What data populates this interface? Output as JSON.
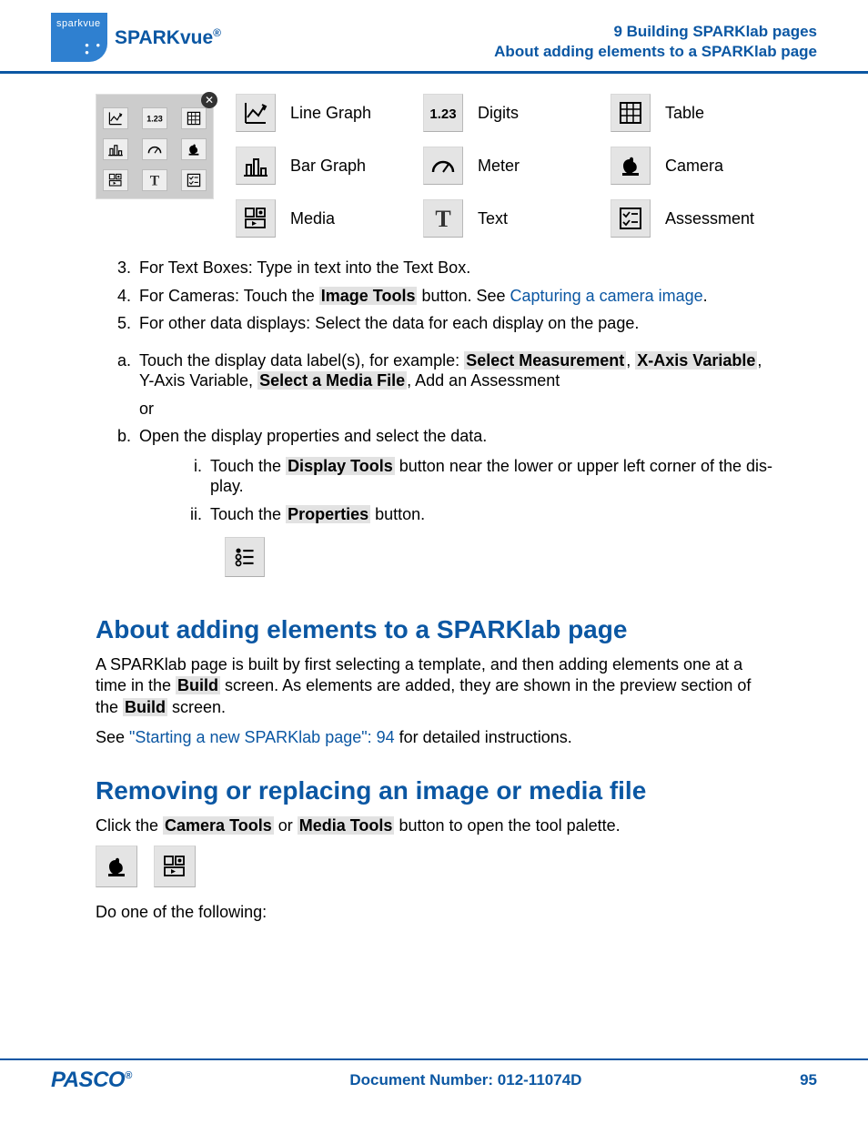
{
  "header": {
    "logo_text": "sparkvue",
    "product_name": "SPARKvue",
    "product_reg": "®",
    "chapter": "9   Building SPARKlab pages",
    "section": "About adding elements to a SPARKlab page"
  },
  "legend_items": [
    {
      "name": "line-graph-icon",
      "glyph": "line",
      "label": "Line Graph"
    },
    {
      "name": "digits-icon",
      "glyph": "digits",
      "label": "Digits"
    },
    {
      "name": "table-icon",
      "glyph": "table",
      "label": "Table"
    },
    {
      "name": "bar-graph-icon",
      "glyph": "bar",
      "label": "Bar Graph"
    },
    {
      "name": "meter-icon",
      "glyph": "meter",
      "label": "Meter"
    },
    {
      "name": "camera-icon",
      "glyph": "camera",
      "label": "Camera"
    },
    {
      "name": "media-icon",
      "glyph": "media",
      "label": "Media"
    },
    {
      "name": "text-icon",
      "glyph": "text",
      "label": "Text"
    },
    {
      "name": "assessment-icon",
      "glyph": "assess",
      "label": "Assess­ment"
    }
  ],
  "mini_palette": [
    "line",
    "digits",
    "table",
    "bar",
    "meter",
    "camera",
    "media",
    "text",
    "assess"
  ],
  "steps": {
    "s3": "For Text Boxes: Type in text into the Text Box.",
    "s4_a": "For Cameras: Touch the ",
    "s4_b": "Image Tools",
    "s4_c": " button. See ",
    "s4_link": "Capturing a camera image",
    "s4_d": ".",
    "s5": "For other data displays: Select the data for each display on the page."
  },
  "alpha": {
    "a_pre": "Touch the display data label(s), for example: ",
    "a_hl1": "Select Measurement",
    "a_sep1": ", ",
    "a_hl2": "X-Axis Vari­able",
    "a_sep2": ", Y-Axis Variable, ",
    "a_hl3": "Select a Media File",
    "a_post": ", Add an Assessment",
    "or": "or",
    "b": "Open the display properties and select the data.",
    "i_pre": "Touch the ",
    "i_hl": "Display Tools",
    "i_post": " button near the lower or upper left corner of the dis­play.",
    "ii_pre": "Touch the ",
    "ii_hl": "Properties",
    "ii_post": " button."
  },
  "sect1": {
    "title": "About adding elements to a SPARKlab page",
    "p1_a": "A SPARKlab page is built by first selecting a template, and then adding elements one at a time in the ",
    "p1_hl1": "Build",
    "p1_b": " screen. As elements are added, they are shown in the preview sec­tion of the ",
    "p1_hl2": "Build",
    "p1_c": " screen.",
    "p2_a": "See ",
    "p2_link": "\"Starting a new SPARKlab page\":  94",
    "p2_b": " for detailed instructions."
  },
  "sect2": {
    "title": "Removing or replacing an image or media file",
    "p1_a": "Click the ",
    "p1_hl1": "Camera Tools",
    "p1_b": " or ",
    "p1_hl2": "Media Tools",
    "p1_c": " button to open the tool palette.",
    "p2": "Do one of the following:"
  },
  "footer": {
    "brand": "PASCO",
    "docnum": "Document Number: 012-11074D",
    "page": "95"
  }
}
